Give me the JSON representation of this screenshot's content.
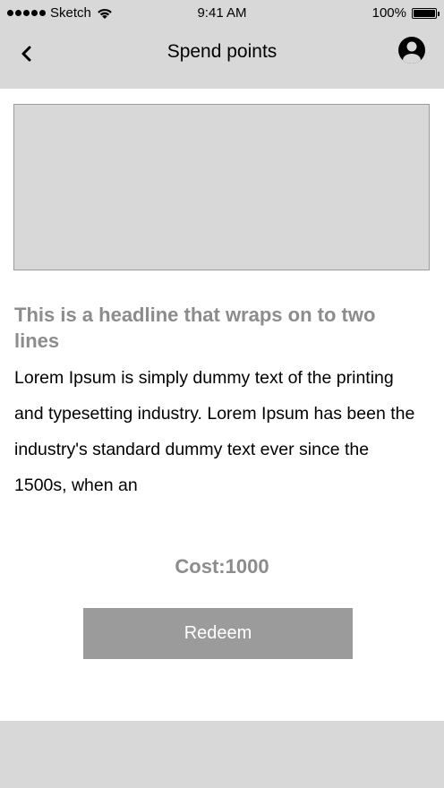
{
  "status_bar": {
    "carrier": "Sketch",
    "time": "9:41 AM",
    "battery": "100%"
  },
  "nav": {
    "title": "Spend points",
    "back_icon": "chevron-left-icon",
    "profile_icon": "user-circle-icon"
  },
  "content": {
    "headline": "This is a headline that wraps on to two lines",
    "body": "Lorem Ipsum is simply dummy text of the printing and typesetting industry. Lorem Ipsum has been the industry's standard dummy text ever since the 1500s, when an",
    "cost": "Cost:1000",
    "redeem_label": "Redeem"
  },
  "colors": {
    "placeholder_gray": "#d8d8d8",
    "button_gray": "#9b9b9b",
    "headline_gray": "#8c8c8c"
  }
}
